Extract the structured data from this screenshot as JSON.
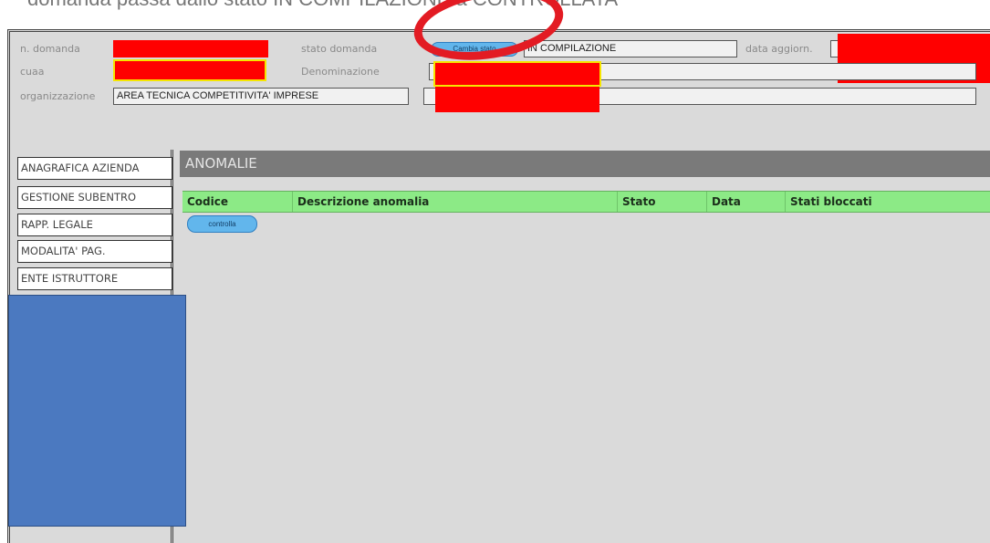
{
  "caption": "domanda passa dallo stato IN COMPILAZIONE a CONTROLLATA",
  "header": {
    "n_domanda_label": "n. domanda",
    "cuaa_label": "cuaa",
    "organizzazione_label": "organizzazione",
    "organizzazione_value": "AREA TECNICA COMPETITIVITA' IMPRESE",
    "stato_domanda_label": "stato domanda",
    "cambia_stato_label": "Cambia stato",
    "stato_value": "IN COMPILAZIONE",
    "denominazione_label": "Denominazione",
    "data_aggiorn_label": "data aggiorn."
  },
  "nav": {
    "items": [
      {
        "label": "ANAGRAFICA AZIENDA"
      },
      {
        "label": "GESTIONE SUBENTRO"
      },
      {
        "label": "RAPP. LEGALE"
      },
      {
        "label": "MODALITA' PAG."
      },
      {
        "label": "ENTE ISTRUTTORE"
      }
    ]
  },
  "main": {
    "section_title": "ANOMALIE",
    "columns": [
      "Codice",
      "Descrizione anomalia",
      "Stato",
      "Data",
      "Stati bloccati"
    ],
    "controlla_label": "controlla"
  },
  "colors": {
    "redaction": "#ff0000",
    "redaction_block": "#4b79c0",
    "highlight_ring": "#e31b23",
    "table_header": "#8cea86",
    "section_bar": "#7a7a7a",
    "button": "#62b6ec"
  }
}
